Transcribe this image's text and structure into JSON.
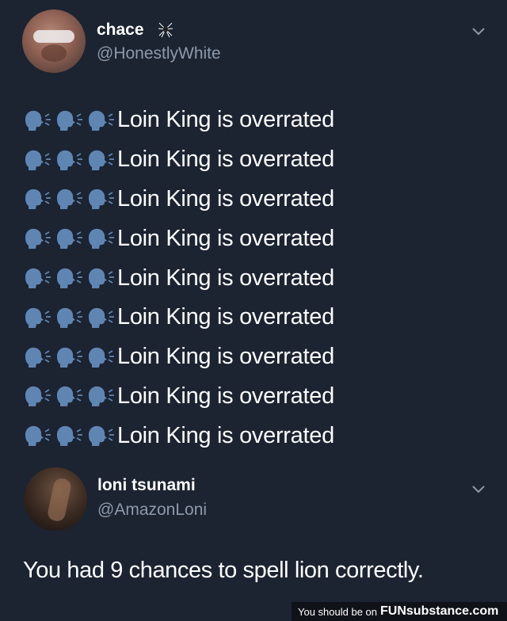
{
  "tweet1": {
    "display_name": "chace",
    "handle": "@HonestlyWhite",
    "lines": [
      "Loin King is overrated",
      "Loin King is overrated",
      "Loin King is overrated",
      "Loin King is overrated",
      "Loin King is overrated",
      "Loin King is overrated",
      "Loin King is overrated",
      "Loin King is overrated",
      "Loin King is overrated"
    ],
    "line_emoji": "speaking-head-icon"
  },
  "tweet2": {
    "display_name": "loni tsunami",
    "handle": "@AmazonLoni",
    "text": "You had 9 chances to spell lion correctly."
  },
  "watermark": {
    "prefix": "You should be on",
    "brand": "FUNsubstance.com"
  },
  "colors": {
    "background": "#1c2331",
    "handle": "#8c9aab",
    "emoji": "#5f86b3"
  }
}
